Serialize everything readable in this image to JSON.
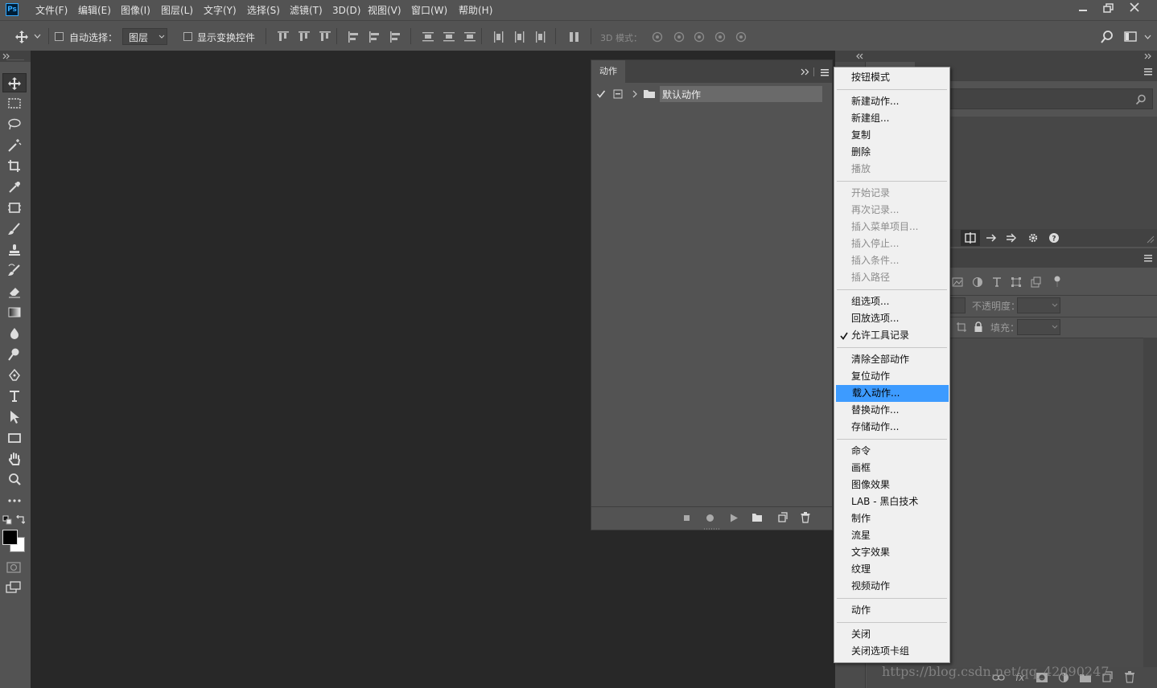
{
  "app": {
    "logo": "Ps"
  },
  "menubar": {
    "items": [
      "文件(F)",
      "编辑(E)",
      "图像(I)",
      "图层(L)",
      "文字(Y)",
      "选择(S)",
      "滤镜(T)",
      "3D(D)",
      "视图(V)",
      "窗口(W)",
      "帮助(H)"
    ]
  },
  "options": {
    "auto_select_label": "自动选择：",
    "auto_select_target": "图层",
    "show_transform_label": "显示变换控件",
    "mode_3d_label": "3D 模式："
  },
  "actions_panel": {
    "tab_label": "动作",
    "default_set_name": "默认动作"
  },
  "layers_panel": {
    "opacity_label": "不透明度：",
    "fill_label": "填充："
  },
  "context_menu": {
    "groups": [
      [
        {
          "label": "按钮模式",
          "enabled": true
        }
      ],
      [
        {
          "label": "新建动作...",
          "enabled": true
        },
        {
          "label": "新建组...",
          "enabled": true
        },
        {
          "label": "复制",
          "enabled": true
        },
        {
          "label": "删除",
          "enabled": true
        },
        {
          "label": "播放",
          "enabled": false
        }
      ],
      [
        {
          "label": "开始记录",
          "enabled": false
        },
        {
          "label": "再次记录...",
          "enabled": false
        },
        {
          "label": "插入菜单项目...",
          "enabled": false
        },
        {
          "label": "插入停止...",
          "enabled": false
        },
        {
          "label": "插入条件...",
          "enabled": false
        },
        {
          "label": "插入路径",
          "enabled": false
        }
      ],
      [
        {
          "label": "组选项...",
          "enabled": true
        },
        {
          "label": "回放选项...",
          "enabled": true
        },
        {
          "label": "允许工具记录",
          "enabled": true,
          "checked": true
        }
      ],
      [
        {
          "label": "清除全部动作",
          "enabled": true
        },
        {
          "label": "复位动作",
          "enabled": true
        },
        {
          "label": "载入动作...",
          "enabled": true,
          "highlighted": true
        },
        {
          "label": "替换动作...",
          "enabled": true
        },
        {
          "label": "存储动作...",
          "enabled": true
        }
      ],
      [
        {
          "label": "命令",
          "enabled": true
        },
        {
          "label": "画框",
          "enabled": true
        },
        {
          "label": "图像效果",
          "enabled": true
        },
        {
          "label": "LAB - 黑白技术",
          "enabled": true
        },
        {
          "label": "制作",
          "enabled": true
        },
        {
          "label": "流星",
          "enabled": true
        },
        {
          "label": "文字效果",
          "enabled": true
        },
        {
          "label": "纹理",
          "enabled": true
        },
        {
          "label": "视频动作",
          "enabled": true
        }
      ],
      [
        {
          "label": "动作",
          "enabled": true
        }
      ],
      [
        {
          "label": "关闭",
          "enabled": true
        },
        {
          "label": "关闭选项卡组",
          "enabled": true
        }
      ]
    ]
  },
  "colors": {
    "highlight": "#3d9bff",
    "ui_gray": "#535353",
    "canvas": "#282828",
    "logo_blue": "#31a8ff"
  },
  "watermark": "https://blog.csdn.net/qq_42090247"
}
